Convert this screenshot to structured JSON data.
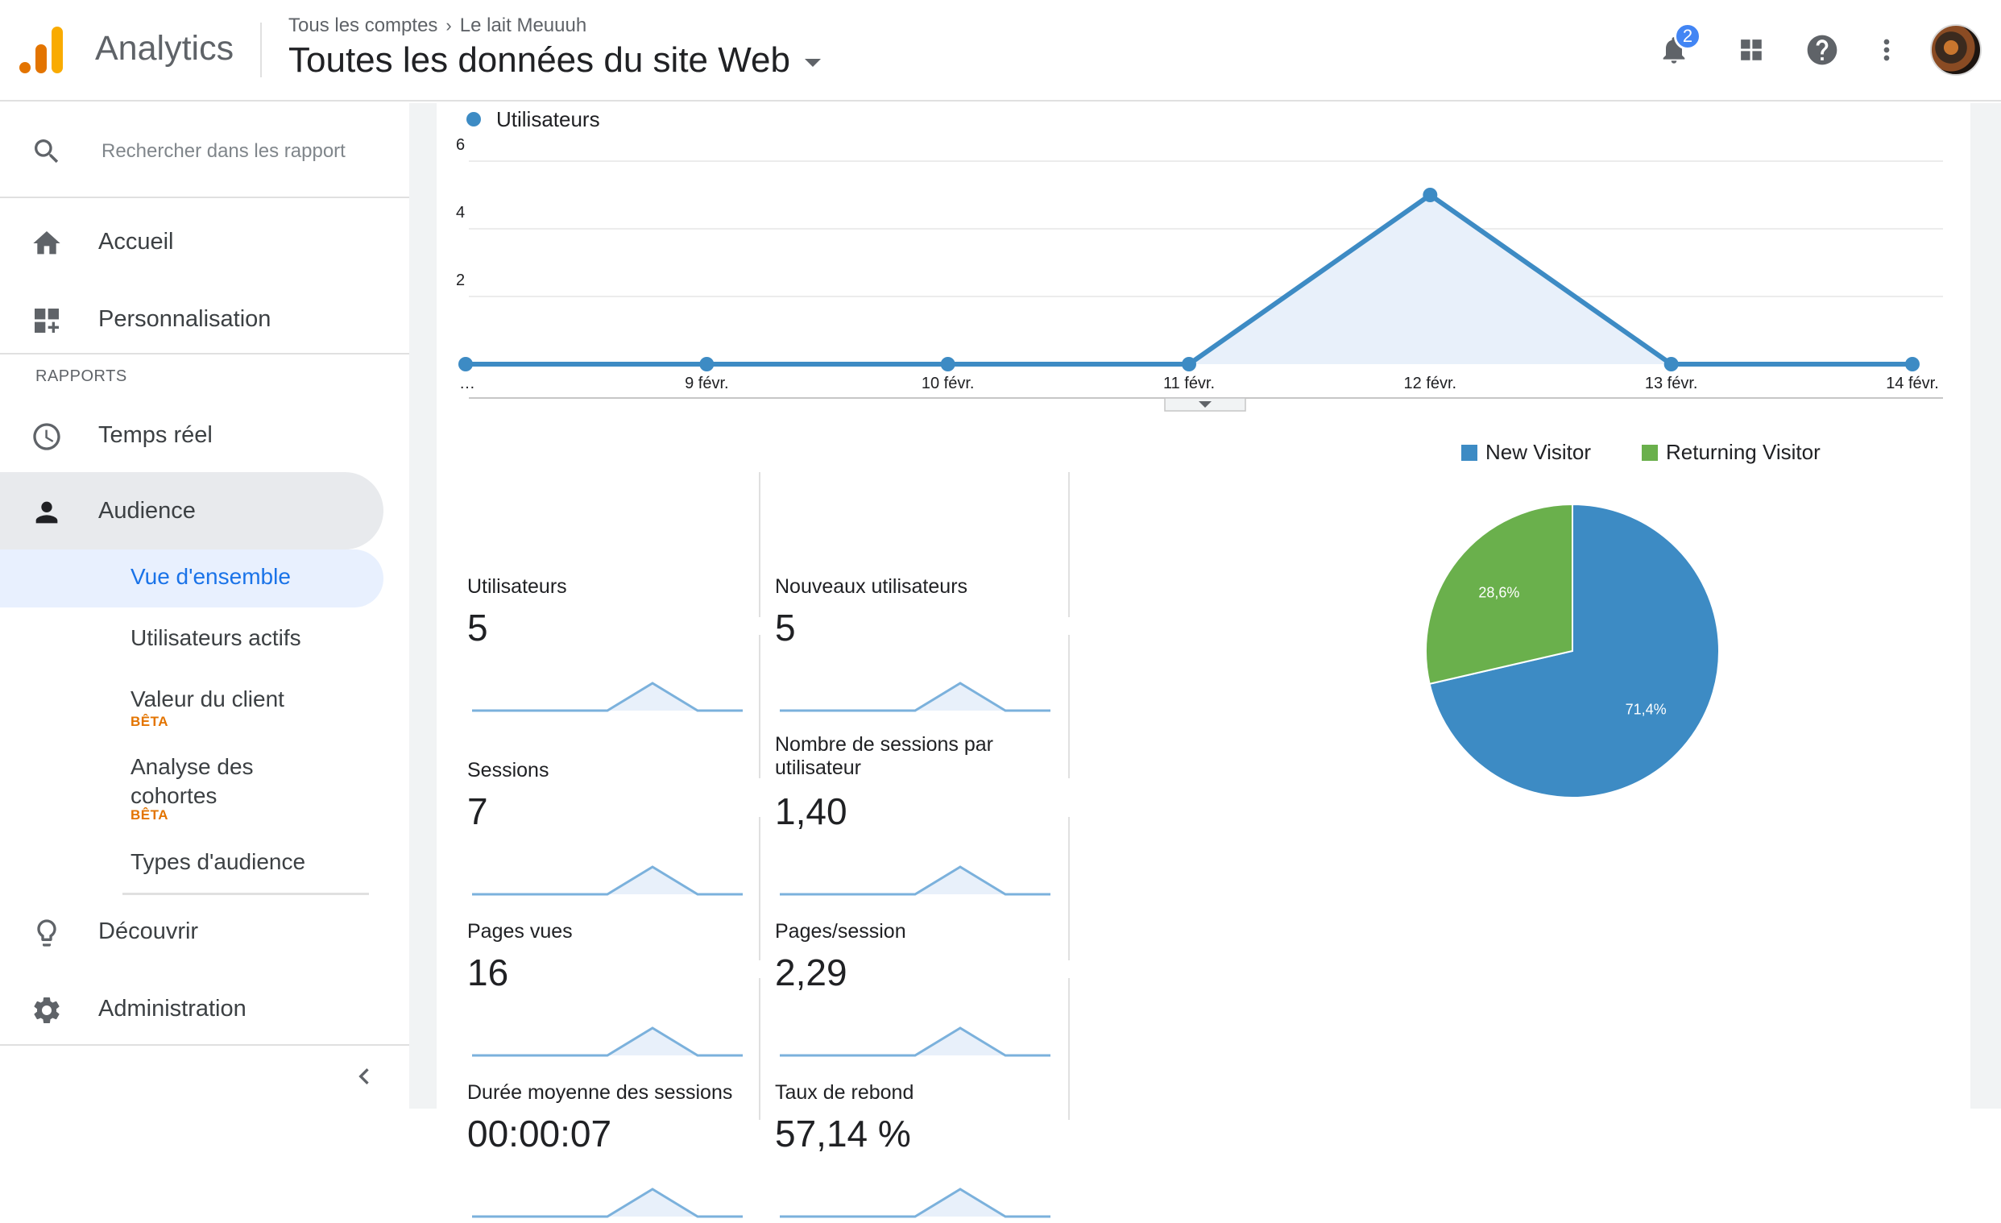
{
  "header": {
    "app_name": "Analytics",
    "breadcrumb": [
      "Tous les comptes",
      "Le lait Meuuuh"
    ],
    "view_title": "Toutes les données du site Web",
    "notification_count": "2"
  },
  "sidebar": {
    "search_placeholder": "Rechercher dans les rapport",
    "top_items": [
      {
        "label": "Accueil",
        "icon": "home-icon"
      },
      {
        "label": "Personnalisation",
        "icon": "dashboard-add-icon"
      }
    ],
    "section_label": "RAPPORTS",
    "report_items": [
      {
        "label": "Temps réel",
        "icon": "clock-icon"
      },
      {
        "label": "Audience",
        "icon": "person-icon",
        "active": true
      }
    ],
    "audience_subitems": [
      {
        "label": "Vue d'ensemble",
        "selected": true
      },
      {
        "label": "Utilisateurs actifs"
      },
      {
        "label": "Valeur du client",
        "badge": "BÊTA"
      },
      {
        "label": "Analyse des cohortes",
        "badge": "BÊTA"
      },
      {
        "label": "Types d'audience"
      }
    ],
    "bottom_items": [
      {
        "label": "Découvrir",
        "icon": "lightbulb-icon"
      },
      {
        "label": "Administration",
        "icon": "gear-icon"
      }
    ]
  },
  "colors": {
    "accent_blue": "#1a73e8",
    "series_blue": "#3d8bc4",
    "new_visitor": "#3d8bc4",
    "returning_visitor": "#6ab04c",
    "beta_orange": "#e37400"
  },
  "chart_data": [
    {
      "type": "area",
      "series": [
        {
          "name": "Utilisateurs",
          "values": [
            0,
            0,
            0,
            0,
            5,
            0,
            0
          ]
        }
      ],
      "categories": [
        "…",
        "9 févr.",
        "10 févr.",
        "11 févr.",
        "12 févr.",
        "13 févr.",
        "14 févr."
      ],
      "yticks": [
        2,
        4,
        6
      ],
      "ylim": [
        0,
        6
      ]
    },
    {
      "type": "pie",
      "categories": [
        "New Visitor",
        "Returning Visitor"
      ],
      "values": [
        71.4,
        28.6
      ],
      "labels": [
        "71,4%",
        "28,6%"
      ]
    }
  ],
  "metrics": [
    {
      "label": "Utilisateurs",
      "value": "5"
    },
    {
      "label": "Nouveaux utilisateurs",
      "value": "5"
    },
    {
      "label": "Sessions",
      "value": "7"
    },
    {
      "label": "Nombre de sessions par utilisateur",
      "value": "1,40"
    },
    {
      "label": "Pages vues",
      "value": "16"
    },
    {
      "label": "Pages/session",
      "value": "2,29"
    },
    {
      "label": "Durée moyenne des sessions",
      "value": "00:00:07"
    },
    {
      "label": "Taux de rebond",
      "value": "57,14 %"
    }
  ]
}
